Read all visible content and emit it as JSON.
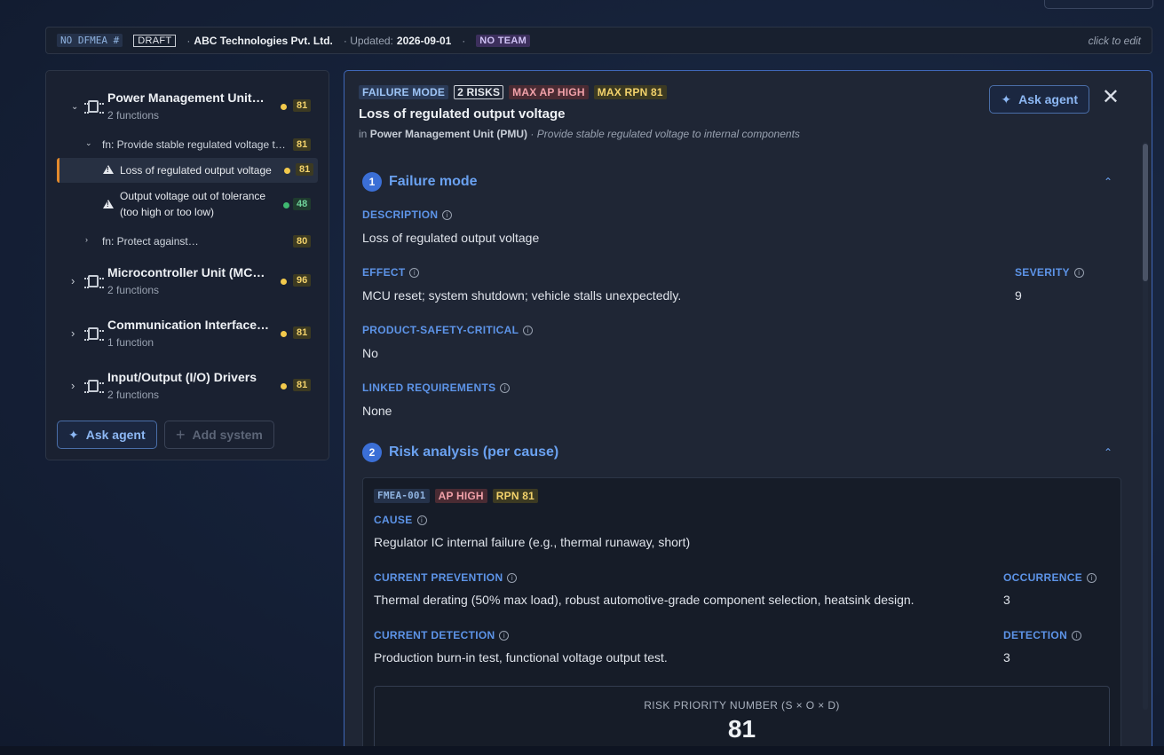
{
  "header": {
    "dfmea_tag": "NO DFMEA #",
    "status": "DRAFT",
    "company": "ABC Technologies Pvt. Ltd.",
    "updated_label": "· Updated:",
    "updated_date": "2026-09-01",
    "team": "NO TEAM",
    "edit_hint": "click to edit"
  },
  "sidebar": {
    "systems": [
      {
        "name": "Power Management Unit…",
        "sub": "2 functions",
        "score": "81",
        "dot": "yellow"
      },
      {
        "name": "Microcontroller Unit (MC…",
        "sub": "2 functions",
        "score": "96",
        "dot": "yellow"
      },
      {
        "name": "Communication Interface…",
        "sub": "1 function",
        "score": "81",
        "dot": "yellow"
      },
      {
        "name": "Input/Output (I/O) Drivers",
        "sub": "2 functions",
        "score": "81",
        "dot": "yellow"
      }
    ],
    "functions": [
      {
        "text": "fn: Provide stable regulated voltage t…",
        "score": "81"
      },
      {
        "text": "fn: Protect against…",
        "score": "80"
      }
    ],
    "failure_modes": [
      {
        "text": "Loss of regulated output voltage",
        "score": "81",
        "dot": "yellow"
      },
      {
        "text_line1": "Output voltage out of tolerance",
        "text_line2": "(too high or too low)",
        "score": "48",
        "dot": "green"
      }
    ],
    "ask_agent_label": "Ask agent",
    "add_system_label": "Add system"
  },
  "detail": {
    "pills": {
      "type": "FAILURE MODE",
      "risks": "2 RISKS",
      "max_ap": "MAX AP HIGH",
      "max_rpn": "MAX RPN 81"
    },
    "title": "Loss of regulated output voltage",
    "in_label": "in",
    "parent": "Power Management Unit (PMU)",
    "function": "· Provide stable regulated voltage to internal components",
    "ask_agent_label": "Ask agent",
    "section1": {
      "num": "1",
      "title": "Failure mode",
      "description_label": "DESCRIPTION",
      "description": "Loss of regulated output voltage",
      "effect_label": "EFFECT",
      "effect": "MCU reset; system shutdown; vehicle stalls unexpectedly.",
      "severity_label": "SEVERITY",
      "severity": "9",
      "safety_label": "PRODUCT-SAFETY-CRITICAL",
      "safety": "No",
      "linked_label": "LINKED REQUIREMENTS",
      "linked": "None"
    },
    "section2": {
      "num": "2",
      "title": "Risk analysis (per cause)",
      "risk": {
        "id": "FMEA-001",
        "ap": "AP HIGH",
        "rpn_pill": "RPN 81",
        "cause_label": "CAUSE",
        "cause": "Regulator IC internal failure (e.g., thermal runaway, short)",
        "prevention_label": "CURRENT PREVENTION",
        "prevention": "Thermal derating (50% max load), robust automotive-grade component selection, heatsink design.",
        "occurrence_label": "OCCURRENCE",
        "occurrence": "3",
        "detection_ctrl_label": "CURRENT DETECTION",
        "detection_ctrl": "Production burn-in test, functional voltage output test.",
        "detection_label": "DETECTION",
        "detection": "3",
        "rpn_label": "RISK PRIORITY NUMBER (S × O × D)",
        "rpn_value": "81"
      }
    }
  }
}
